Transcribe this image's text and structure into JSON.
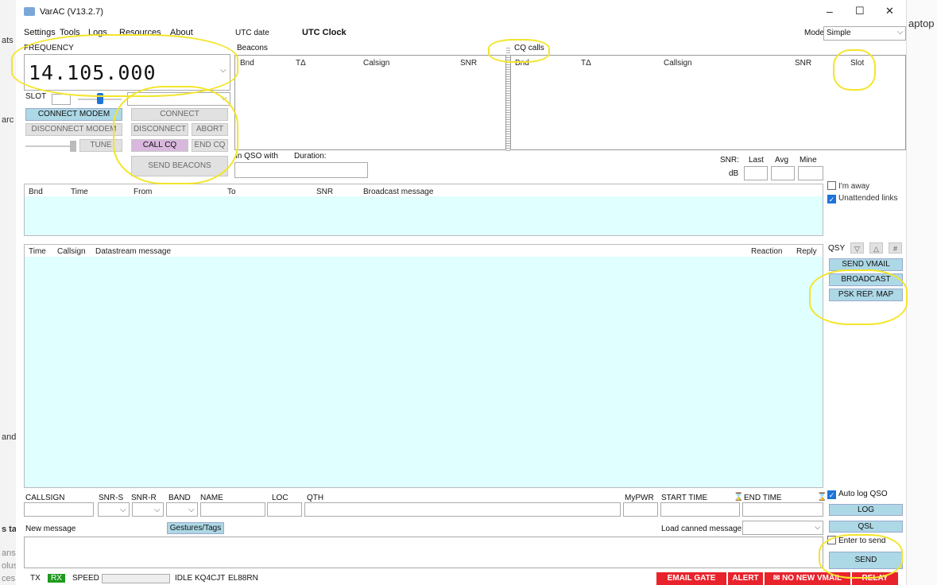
{
  "window": {
    "title": "VarAC (V13.2.7)",
    "min": "–",
    "max": "☐",
    "close": "✕"
  },
  "bg": {
    "left": [
      "ats",
      "arc",
      "and",
      "s ta",
      "ans",
      "olus",
      "ces."
    ],
    "right": "aptop"
  },
  "menu": [
    "Settings",
    "Tools",
    "Logs",
    "Resources",
    "About"
  ],
  "utc": {
    "date": "UTC date",
    "clock": "UTC Clock"
  },
  "mode": {
    "label": "Mode",
    "value": "Simple"
  },
  "frequency": {
    "label": "FREQUENCY",
    "value": "14.105.000"
  },
  "slot": {
    "label": "SLOT"
  },
  "buttons": {
    "connect_modem": "CONNECT MODEM",
    "disconnect_modem": "DISCONNECT MODEM",
    "tune": "TUNE",
    "connect": "CONNECT",
    "disconnect": "DISCONNECT",
    "abort": "ABORT",
    "call_cq": "CALL CQ",
    "end_cq": "END CQ",
    "send_beacons": "SEND BEACONS",
    "send_vmail": "SEND VMAIL",
    "broadcast": "BROADCAST",
    "psk_map": "PSK REP. MAP",
    "log": "LOG",
    "qsl": "QSL",
    "send": "SEND",
    "gestures": "Gestures/Tags"
  },
  "beacons": {
    "title": "Beacons",
    "cols": [
      "Bnd",
      "TΔ",
      "Calsign",
      "SNR"
    ]
  },
  "cq": {
    "title": "CQ calls",
    "cols": [
      "Bnd",
      "TΔ",
      "Callsign",
      "SNR",
      "Slot"
    ]
  },
  "qso": {
    "in_qso": "In QSO with",
    "duration": "Duration:"
  },
  "snr": {
    "label": "SNR:",
    "db": "dB",
    "last": "Last",
    "avg": "Avg",
    "mine": "Mine"
  },
  "broadcast_cols": [
    "Bnd",
    "Time",
    "From",
    "To",
    "SNR",
    "Broadcast message"
  ],
  "flags": {
    "away": "I'm away",
    "unattended": "Unattended links",
    "auto_log": "Auto log QSO",
    "enter_send": "Enter to send"
  },
  "datastream": {
    "cols": [
      "Time",
      "Callsign",
      "Datastream message"
    ],
    "reaction": "Reaction",
    "reply": "Reply"
  },
  "qsy": {
    "label": "QSY",
    "down": "▽",
    "up": "△",
    "hash": "#"
  },
  "fields": {
    "callsign": "CALLSIGN",
    "snr_s": "SNR-S",
    "snr_r": "SNR-R",
    "band": "BAND",
    "name": "NAME",
    "loc": "LOC",
    "qth": "QTH",
    "mypwr": "MyPWR",
    "start": "START TIME",
    "end": "END TIME",
    "hourglass": "⌛"
  },
  "new_msg": "New message",
  "canned": "Load canned message:",
  "status": {
    "tx": "TX",
    "rx": "RX",
    "speed": "SPEED",
    "idle": "IDLE",
    "call": "KQ4CJT",
    "grid": "EL88RN",
    "email": "EMAIL GATE",
    "alert": "ALERT",
    "vmail": "✉ NO NEW VMAIL",
    "relay": "RELAY"
  },
  "colors": {
    "cyan": "#e0ffff",
    "blue_button": "#add8e6",
    "rx_green": "#1e9a1e",
    "alert_red": "#e8232c",
    "highlight": "#f3e52a"
  }
}
